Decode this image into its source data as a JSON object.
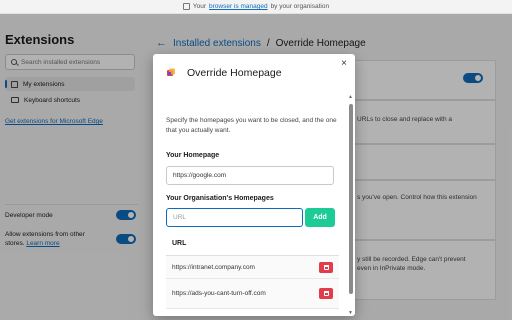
{
  "managed": {
    "prefix": "Your",
    "link": "browser is managed",
    "suffix": "by your organisation"
  },
  "sidebar": {
    "title": "Extensions",
    "search_placeholder": "Search installed extensions",
    "items": [
      {
        "label": "My extensions",
        "icon": "extension-icon",
        "active": true
      },
      {
        "label": "Keyboard shortcuts",
        "icon": "keyboard-icon",
        "active": false
      }
    ],
    "get_link": "Get extensions for Microsoft Edge",
    "developer_mode": "Developer mode",
    "allow_other": "Allow extensions from other stores.",
    "learn_more": "Learn more"
  },
  "main": {
    "crumb_link": "Installed extensions",
    "crumb_sep": "/",
    "crumb_current": "Override Homepage",
    "bg_texts": [
      "URLs to close and replace with a",
      "s you've open. Control how this extension",
      "y still be recorded. Edge can't prevent",
      "even in InPrivate mode."
    ]
  },
  "dialog": {
    "title": "Override Homepage",
    "close": "×",
    "description": "Specify the homepages you want to be closed, and the one that you actually want.",
    "homepage_label": "Your Homepage",
    "homepage_value": "https://google.com",
    "org_label": "Your Organisation's Homepages",
    "url_placeholder": "URL",
    "add_label": "Add",
    "table_header": "URL",
    "rows": [
      "https://intranet.company.com",
      "https://ads-you-cant-turn-off.com"
    ]
  },
  "colors": {
    "accent": "#0f6cbd",
    "add_green": "#1ccb95",
    "delete_red": "#e23b4a"
  }
}
